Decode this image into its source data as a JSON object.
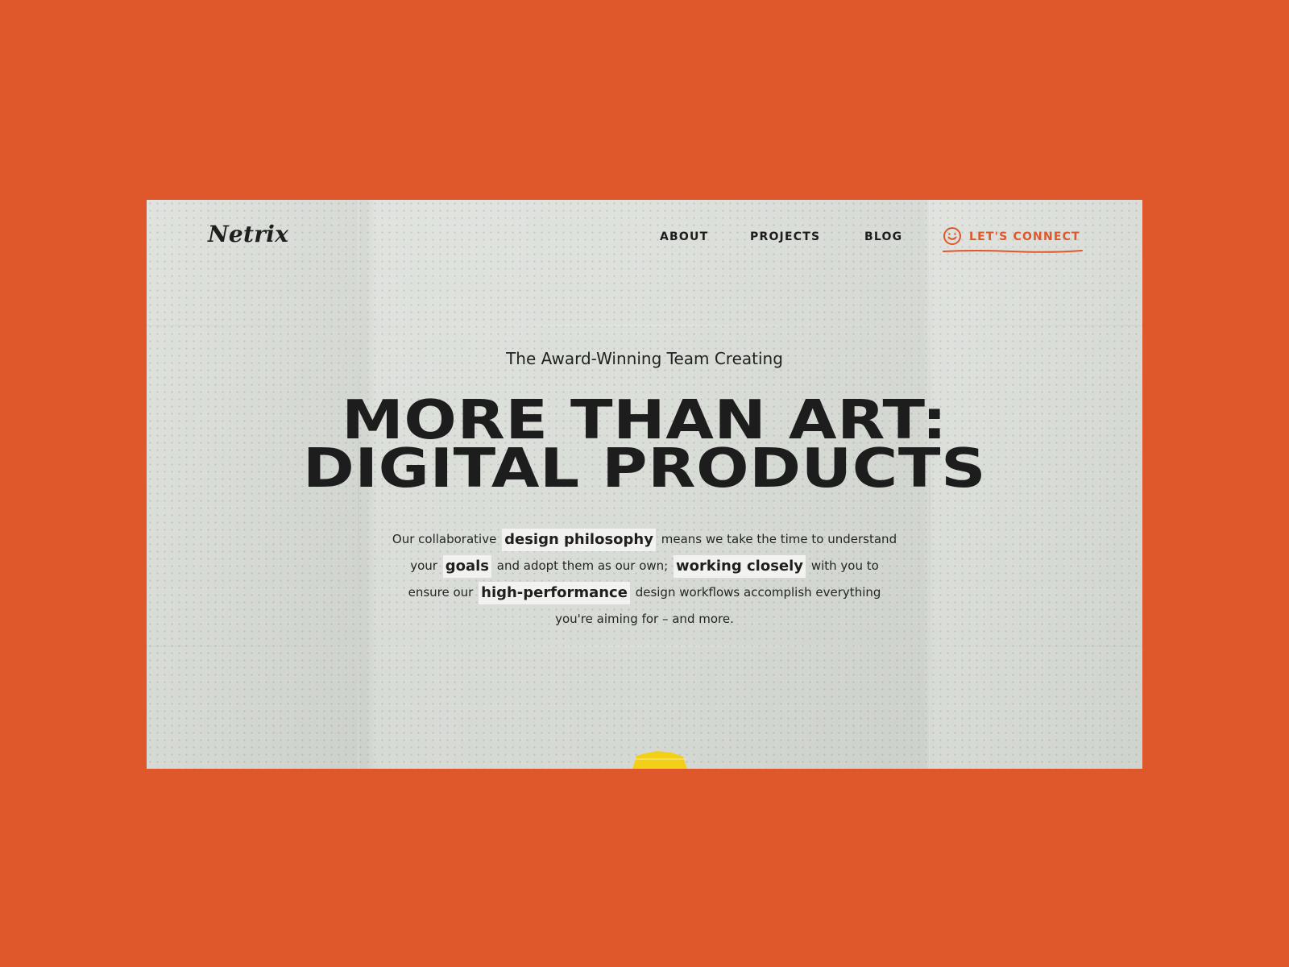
{
  "brand": {
    "name": "Netrix"
  },
  "nav": {
    "about": "ABOUT",
    "projects": "PROJECTS",
    "blog": "BLOG",
    "connect": "LET'S CONNECT"
  },
  "hero": {
    "kicker": "The Award-Winning Team Creating",
    "title_lines": [
      "MORE THAN ART:",
      "DIGITAL PRODUCTS"
    ],
    "description": {
      "t1": "Our collaborative",
      "h1": "design philosophy",
      "t2": "means we take the time to understand your",
      "h2": "goals",
      "t3": "and adopt them as our own;",
      "h3": "working closely",
      "t4": "with you to ensure our",
      "h4": "high-performance",
      "t5": "design workflows accomplish everything you're aiming for – and more."
    }
  },
  "colors": {
    "accent": "#df582c",
    "paper": "#d8dcd6",
    "ink": "#1d1d1d",
    "highlight": "#f2f3f1",
    "tape": "#f2d018"
  }
}
